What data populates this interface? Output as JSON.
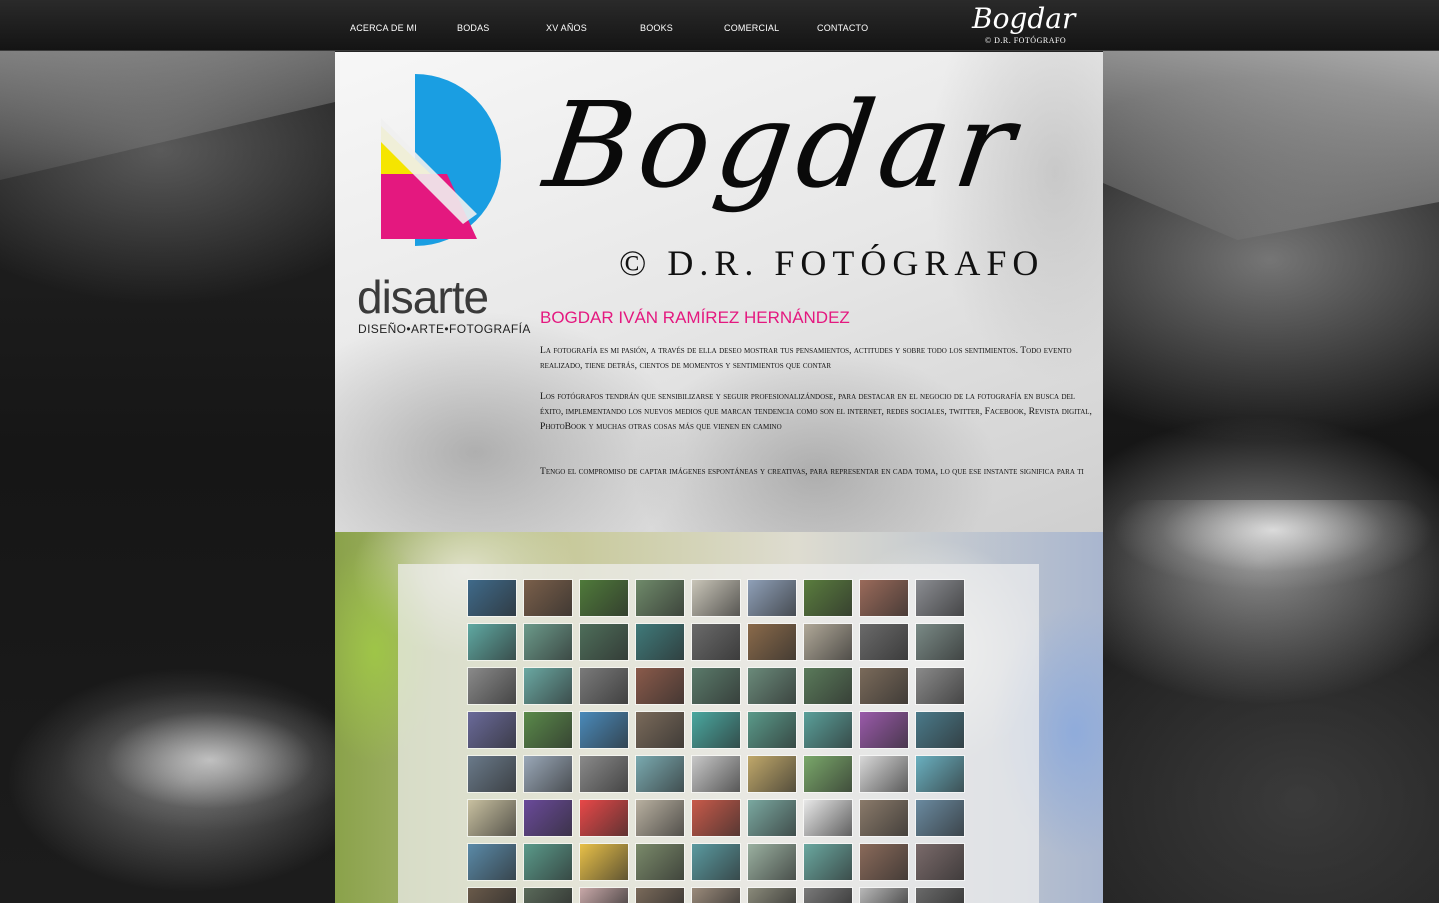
{
  "nav": {
    "items": [
      {
        "label": "ACERCA DE MI"
      },
      {
        "label": "BODAS"
      },
      {
        "label": "XV AÑOS"
      },
      {
        "label": "BOOKS"
      },
      {
        "label": "COMERCIAL"
      },
      {
        "label": "CONTACTO"
      }
    ],
    "brand_script": "Bogdar",
    "brand_sub": "© D.R. FOTÓGRAFO"
  },
  "hero": {
    "logo_word": "disarte",
    "logo_tagline": "DISEÑO•ARTE•FOTOGRAFÍA",
    "title_script": "Bogdar",
    "title_sub": "© D.R. FOTÓGRAFO",
    "name": "BOGDAR IVÁN RAMÍREZ HERNÁNDEZ",
    "paragraphs": [
      "La fotografía es mi pasión, a través de ella deseo mostrar tus pensamientos, actitudes y sobre todo los sentimientos. Todo evento realizado, tiene detrás, cientos de momentos y sentimientos que contar",
      "Los fotógrafos tendrán que sensibilizarse y seguir profesionalizándose, para destacar en el negocio de la fotografía en busca del éxito, implementando los nuevos medios que marcan tendencia como son el internet, redes sociales, twitter, Facebook, Revista digital, PhotoBook y muchas otras cosas más que vienen en camino",
      "Tengo el compromiso de captar imágenes espontáneas y creativas, para representar en cada toma, lo que ese instante significa para ti"
    ]
  },
  "colors": {
    "accent": "#e4187f",
    "logo_blue": "#1a9ee2",
    "logo_yellow": "#f5e500",
    "logo_magenta": "#e4187f"
  },
  "gallery": {
    "rows": [
      [
        "#3f6a8a",
        "#7a5f4a",
        "#4f7a3a",
        "#6f8a6a",
        "#c9c5b8",
        "#8fa0b8",
        "#5a7d3e",
        "#9a6a5a",
        "#8b8d92"
      ],
      [
        "#5fa9a2",
        "#6b9a8a",
        "#4e6e5a",
        "#3f7a7a",
        "#6a6a6a",
        "#8a6a4a",
        "#b0a898",
        "#6a6a6a",
        "#7a8a86"
      ],
      [
        "#8a8a8a",
        "#6aa8a2",
        "#7a7a7a",
        "#8a5a4a",
        "#5a7a6a",
        "#6a8a7a",
        "#5a7a5a",
        "#7a6a5a",
        "#8a8a8a"
      ],
      [
        "#6a6a9a",
        "#5a8a4a",
        "#4a8aba",
        "#7a6a5a",
        "#4aa8a0",
        "#5a9a8a",
        "#5aa09a",
        "#9a5aaa",
        "#4a7a8a"
      ],
      [
        "#6a7a8a",
        "#9aa8b8",
        "#8a8a8a",
        "#7aaab0",
        "#c8c8c8",
        "#c0a86a",
        "#7aa86a",
        "#d8d8d8",
        "#6ab0c0"
      ],
      [
        "#c8c0a0",
        "#6a4a9a",
        "#e84848",
        "#b8b0a0",
        "#c85a4a",
        "#7aa8a0",
        "#e8e8e8",
        "#8a7a6a",
        "#6a8aa0"
      ],
      [
        "#5a8aa8",
        "#5a9a8a",
        "#e8c048",
        "#7a8a6a",
        "#5a9aa0",
        "#9ab0a0",
        "#6aa8a0",
        "#8a6a5a",
        "#7a6a6a"
      ],
      [
        "#6a5a4a",
        "#5a6a5a",
        "#c8a8a8",
        "#7a6a5a",
        "#9a8a7a",
        "#8a8a7a",
        "#7a7a7a",
        "#b8b8b8",
        "#6a6a6a"
      ]
    ]
  }
}
